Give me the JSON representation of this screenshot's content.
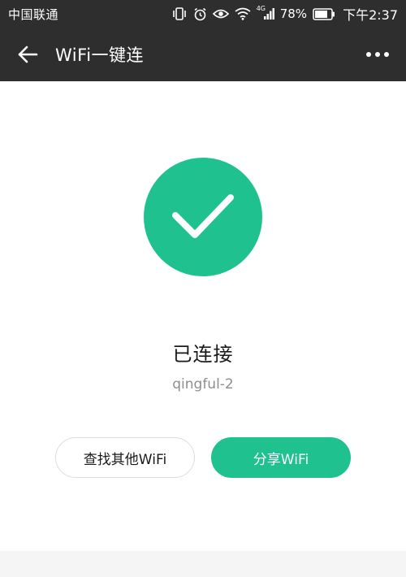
{
  "status_bar": {
    "carrier": "中国联通",
    "signal_type": "4G",
    "battery": "78%",
    "time": "下午2:37",
    "icons": [
      "vibrate-icon",
      "alarm-icon",
      "eye-icon",
      "wifi-icon",
      "cellular-icon",
      "battery-icon"
    ]
  },
  "nav": {
    "title": "WiFi一键连",
    "back_icon": "arrow-left-icon",
    "more_icon": "more-dots-icon"
  },
  "result": {
    "icon": "check-icon",
    "status": "已连接",
    "ssid": "qingful-2"
  },
  "actions": {
    "find_other": "查找其他WiFi",
    "share": "分享WiFi"
  },
  "colors": {
    "accent": "#1fc18f",
    "bar_background": "#2e2e2e"
  }
}
